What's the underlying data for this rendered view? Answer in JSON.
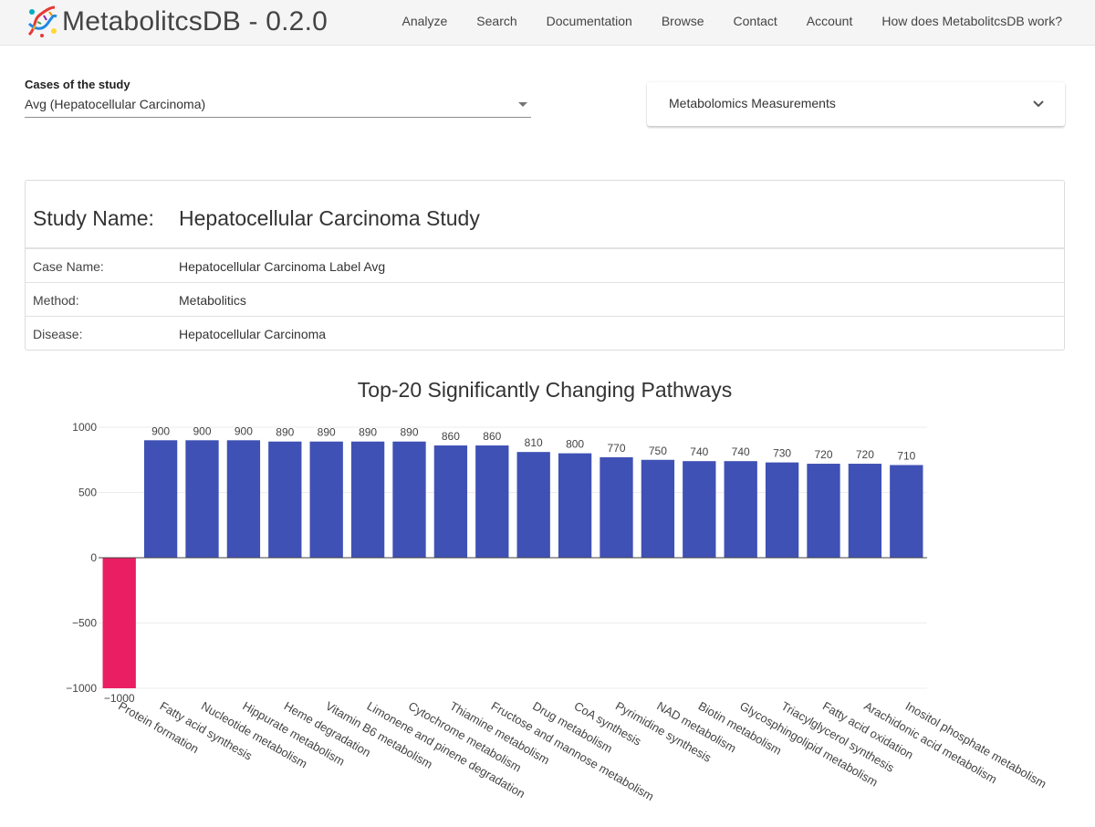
{
  "app": {
    "title": "MetabolitcsDB - 0.2.0",
    "logo_icon": "dna-helix-logo-icon"
  },
  "nav": {
    "items": [
      {
        "label": "Analyze"
      },
      {
        "label": "Search"
      },
      {
        "label": "Documentation"
      },
      {
        "label": "Browse"
      },
      {
        "label": "Contact"
      },
      {
        "label": "Account"
      },
      {
        "label": "How does MetabolitcsDB work?"
      }
    ]
  },
  "case_select": {
    "label": "Cases of the study",
    "value": "Avg (Hepatocellular Carcinoma)"
  },
  "measurements_panel": {
    "title": "Metabolomics Measurements",
    "icon": "chevron-down-icon"
  },
  "study": {
    "name_label": "Study Name:",
    "name_value": "Hepatocellular Carcinoma Study",
    "rows": [
      {
        "label": "Case Name:",
        "value": "Hepatocellular Carcinoma Label Avg"
      },
      {
        "label": "Method:",
        "value": "Metabolitics"
      },
      {
        "label": "Disease:",
        "value": "Hepatocellular Carcinoma"
      }
    ]
  },
  "chart_data": {
    "type": "bar",
    "title": "Top-20 Significantly Changing Pathways",
    "xlabel": "",
    "ylabel": "",
    "ylim": [
      -1000,
      1000
    ],
    "yticks": [
      1000,
      500,
      0,
      -500,
      -1000
    ],
    "ytick_labels": [
      "1000",
      "500",
      "0",
      "−500",
      "−1000"
    ],
    "grid": true,
    "colors": {
      "positive": "#3f51b5",
      "negative": "#e91e63"
    },
    "categories": [
      "Protein formation",
      "Fatty acid synthesis",
      "Nucleotide metabolism",
      "Hippurate metabolism",
      "Heme degradation",
      "Vitamin B6 metabolism",
      "Limonene and pinene degradation",
      "Cytochrome metabolism",
      "Thiamine metabolism",
      "Fructose and mannose metabolism",
      "Drug metabolism",
      "CoA synthesis",
      "Pyrimidine synthesis",
      "NAD metabolism",
      "Biotin metabolism",
      "Glycosphingolipid metabolism",
      "Triacylglycerol synthesis",
      "Fatty acid oxidation",
      "Arachidonic acid metabolism",
      "Inositol phosphate metabolism"
    ],
    "values": [
      -1000,
      900,
      900,
      900,
      890,
      890,
      890,
      890,
      860,
      860,
      810,
      800,
      770,
      750,
      740,
      740,
      730,
      720,
      720,
      710
    ],
    "value_labels": [
      "−1000",
      "900",
      "900",
      "900",
      "890",
      "890",
      "890",
      "890",
      "860",
      "860",
      "810",
      "800",
      "770",
      "750",
      "740",
      "740",
      "730",
      "720",
      "720",
      "710"
    ]
  }
}
